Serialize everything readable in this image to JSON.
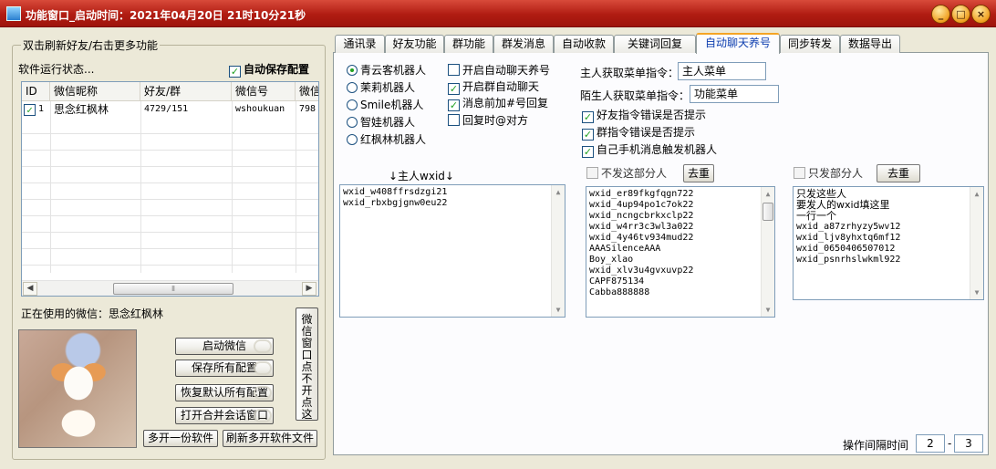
{
  "window": {
    "title": "功能窗口_启动时间：2021年04月20日 21时10分21秒",
    "buttons": [
      "_",
      "□",
      "×"
    ]
  },
  "left": {
    "group_title": "双击刷新好友/右击更多功能",
    "status_label": "软件运行状态...",
    "autosave": {
      "label": "自动保存配置",
      "checked": true
    },
    "table": {
      "headers": [
        "ID",
        "微信昵称",
        "好友/群",
        "微信号",
        "微信"
      ],
      "rows": [
        {
          "checked": true,
          "id": "1",
          "nick": "思念红枫林",
          "friends": "4729/151",
          "wxid": "wshoukuan",
          "extra": "798"
        }
      ]
    },
    "current_user_label": "正在使用的微信：思念红枫林",
    "buttons": {
      "start": "启动微信",
      "save_all": "保存所有配置",
      "restore": "恢复默认所有配置",
      "open_merge": "打开合并会话窗口",
      "multi_open": "多开一份软件",
      "refresh_multi": "刷新多开软件文件",
      "window_click": "微信窗口点不开点这"
    }
  },
  "tabs": [
    {
      "label": "通讯录",
      "active": false
    },
    {
      "label": "好友功能",
      "active": false
    },
    {
      "label": "群功能",
      "active": false
    },
    {
      "label": "群发消息",
      "active": false
    },
    {
      "label": "自动收款",
      "active": false
    },
    {
      "label": "关键词回复",
      "active": false
    },
    {
      "label": "自动聊天养号",
      "active": true
    },
    {
      "label": "同步转发",
      "active": false
    },
    {
      "label": "数据导出",
      "active": false
    }
  ],
  "panel": {
    "robots": [
      {
        "label": "青云客机器人",
        "selected": true
      },
      {
        "label": "茉莉机器人",
        "selected": false
      },
      {
        "label": "Smile机器人",
        "selected": false
      },
      {
        "label": "智娃机器人",
        "selected": false
      },
      {
        "label": "红枫林机器人",
        "selected": false
      }
    ],
    "options": [
      {
        "label": "开启自动聊天养号",
        "checked": false
      },
      {
        "label": "开启群自动聊天",
        "checked": true
      },
      {
        "label": "消息前加#号回复",
        "checked": true
      },
      {
        "label": "回复时@对方",
        "checked": false
      }
    ],
    "master_cmd": {
      "label": "主人获取菜单指令：",
      "value": "主人菜单"
    },
    "stranger_cmd": {
      "label": "陌生人获取菜单指令：",
      "value": "功能菜单"
    },
    "prompts": [
      {
        "label": "好友指令错误是否提示",
        "checked": true
      },
      {
        "label": "群指令错误是否提示",
        "checked": true
      },
      {
        "label": "自己手机消息触发机器人",
        "checked": true
      }
    ],
    "master_list": {
      "title": "↓主人wxid↓",
      "items": [
        "wxid_w408ffrsdzgi21",
        "wxid_rbxbgjgnw0eu22"
      ]
    },
    "exclude_list": {
      "label": "不发这部分人",
      "checked": false,
      "button": "去重",
      "items": [
        "wxid_er89fkgfqgn722",
        "wxid_4up94po1c7ok22",
        "wxid_ncngcbrkxclp22",
        "wxid_w4rr3c3wl3a022",
        "wxid_4y46tv934mud22",
        "AAASilenceAAA",
        "Boy_xlao",
        "wxid_xlv3u4gvxuvp22",
        "CAPF875134",
        "Cabba888888"
      ]
    },
    "only_list": {
      "label": "只发部分人",
      "checked": false,
      "button": "去重",
      "items": [
        "只发这些人",
        "要发人的wxid填这里",
        "一行一个",
        "wxid_a87zrhyzy5wv12",
        "wxid_ljv8yhxtq6mf12",
        "wxid_0650406507012",
        "wxid_psnrhslwkml922"
      ]
    },
    "interval": {
      "label": "操作间隔时间",
      "min": "2",
      "sep": "-",
      "max": "3"
    }
  }
}
